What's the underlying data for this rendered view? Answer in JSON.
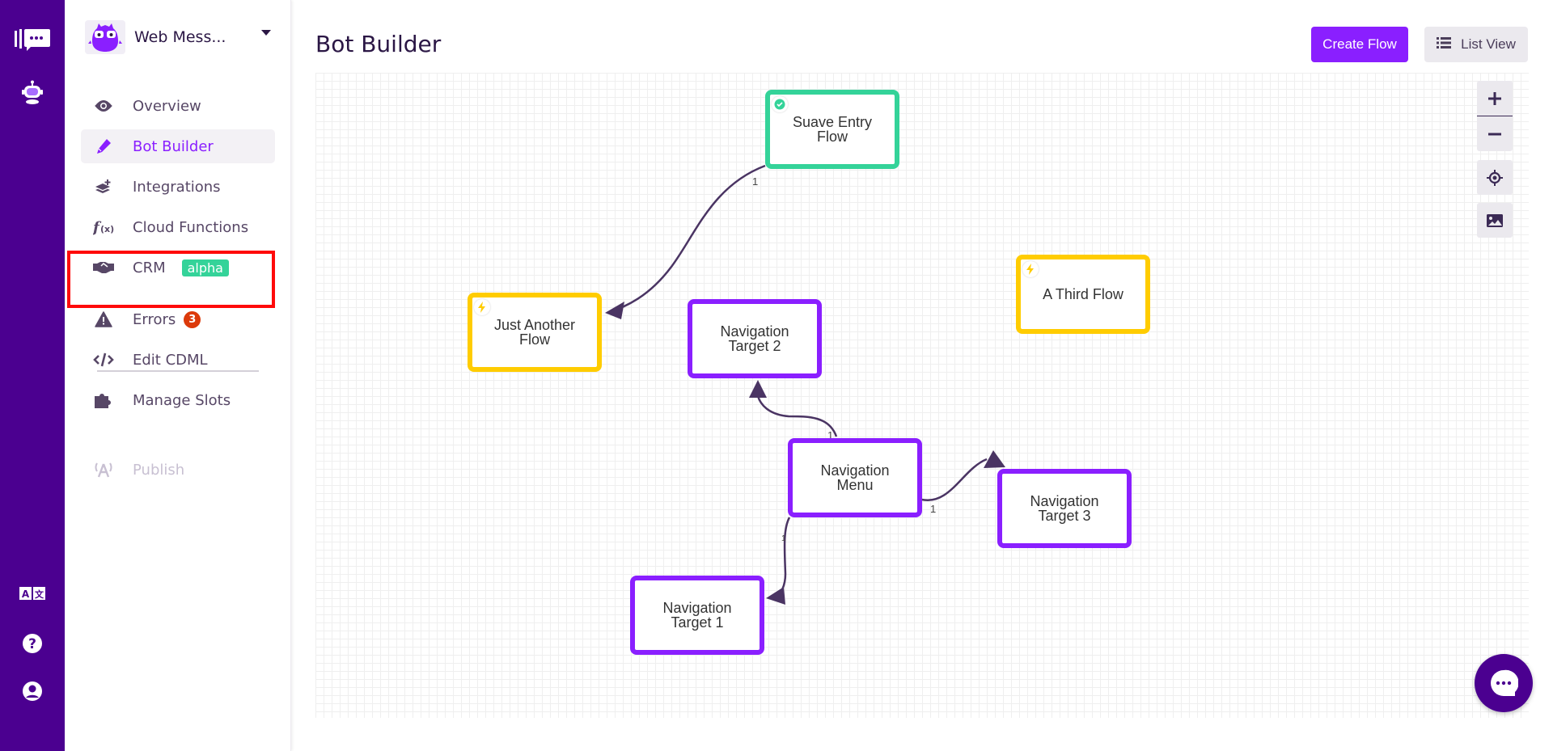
{
  "rail": {
    "icons": [
      "brand-logo-icon",
      "bot-icon",
      "translate-icon",
      "help-icon",
      "user-account-icon"
    ]
  },
  "sidebar": {
    "bot_name": "Web Mess...",
    "items": [
      {
        "label": "Overview",
        "icon": "eye-icon"
      },
      {
        "label": "Bot Builder",
        "icon": "pencil-icon",
        "active": true
      },
      {
        "label": "Integrations",
        "icon": "layers-plus-icon"
      },
      {
        "label": "Cloud Functions",
        "icon": "function-icon"
      },
      {
        "label": "CRM",
        "icon": "handshake-icon",
        "badge": "alpha"
      },
      {
        "label": "Errors",
        "icon": "warning-icon",
        "count": "3"
      },
      {
        "label": "Edit CDML",
        "icon": "code-icon"
      },
      {
        "label": "Manage Slots",
        "icon": "puzzle-icon"
      },
      {
        "label": "Publish",
        "icon": "broadcast-icon",
        "disabled": true
      }
    ]
  },
  "header": {
    "title": "Bot Builder",
    "create_flow_label": "Create Flow",
    "list_view_label": "List View"
  },
  "canvas": {
    "controls": [
      "zoom-in",
      "zoom-out",
      "recenter",
      "export-image"
    ],
    "nodes": [
      {
        "id": "suave",
        "label": "Suave Entry Flow",
        "type": "entry",
        "badge": "check"
      },
      {
        "id": "just",
        "label": "Just Another Flow",
        "type": "trigger",
        "badge": "bolt"
      },
      {
        "id": "third",
        "label": "A Third Flow",
        "type": "trigger",
        "badge": "bolt"
      },
      {
        "id": "nav2",
        "label": "Navigation Target 2",
        "type": "nav"
      },
      {
        "id": "navmenu",
        "label": "Navigation Menu",
        "type": "nav"
      },
      {
        "id": "nav3",
        "label": "Navigation Target 3",
        "type": "nav"
      },
      {
        "id": "nav1",
        "label": "Navigation Target 1",
        "type": "nav"
      }
    ],
    "edges": [
      {
        "from": "suave",
        "to": "just",
        "label": "1"
      },
      {
        "from": "navmenu",
        "to": "nav2",
        "label": "1"
      },
      {
        "from": "navmenu",
        "to": "nav3",
        "label": "1"
      },
      {
        "from": "navmenu",
        "to": "nav1",
        "label": "1"
      }
    ]
  },
  "colors": {
    "brand": "#4b0090",
    "accent": "#8a1fff",
    "entry": "#34d399",
    "trigger": "#ffcc00",
    "error": "#dc3a0a",
    "highlight": "#ff0a0a"
  }
}
